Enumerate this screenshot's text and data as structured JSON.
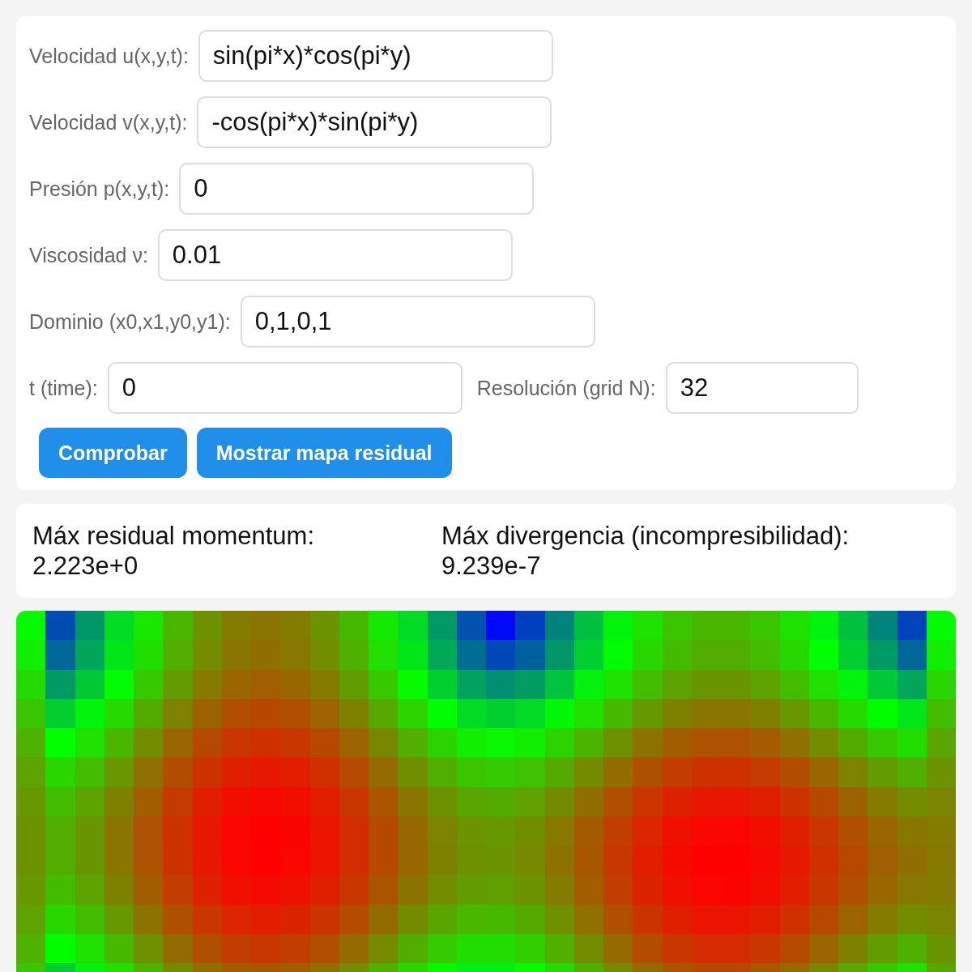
{
  "form": {
    "rows": [
      {
        "fields": [
          {
            "label": "Velocidad u(x,y,t):",
            "value": "sin(pi*x)*cos(pi*y)"
          }
        ]
      },
      {
        "fields": [
          {
            "label": "Velocidad v(x,y,t):",
            "value": "-cos(pi*x)*sin(pi*y)"
          }
        ]
      },
      {
        "fields": [
          {
            "label": "Presión p(x,y,t):",
            "value": "0"
          }
        ]
      },
      {
        "fields": [
          {
            "label": "Viscosidad ν:",
            "value": "0.01"
          }
        ]
      },
      {
        "fields": [
          {
            "label": "Dominio (x0,x1,y0,y1):",
            "value": "0,1,0,1"
          }
        ]
      },
      {
        "fields": [
          {
            "label": "t (time):",
            "value": "0"
          },
          {
            "label": "Resolución (grid N):",
            "value": "32"
          }
        ]
      }
    ],
    "buttons": [
      "Comprobar",
      "Mostrar mapa residual"
    ]
  },
  "results": [
    {
      "label": "Máx residual momentum:",
      "value": "2.223e+0"
    },
    {
      "label": "Máx divergencia (incompresibilidad):",
      "value": "9.239e-7"
    }
  ]
}
